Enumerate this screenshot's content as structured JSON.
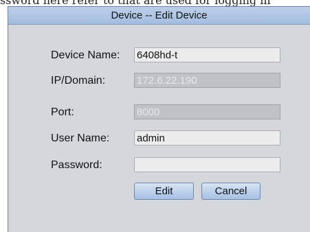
{
  "header": {
    "caption": "ssword here refer to that are used for logging in"
  },
  "dialog": {
    "title": "Device -- Edit Device",
    "fields": [
      {
        "label": "Device Name:",
        "value": "6408hd-t"
      },
      {
        "label": "IP/Domain:",
        "value": "172.6.22.190"
      },
      {
        "label": "Port:",
        "value": "8000"
      },
      {
        "label": "User Name:",
        "value": "admin"
      },
      {
        "label": "Password:",
        "value": ""
      }
    ],
    "buttons": {
      "edit": "Edit",
      "cancel": "Cancel"
    }
  }
}
